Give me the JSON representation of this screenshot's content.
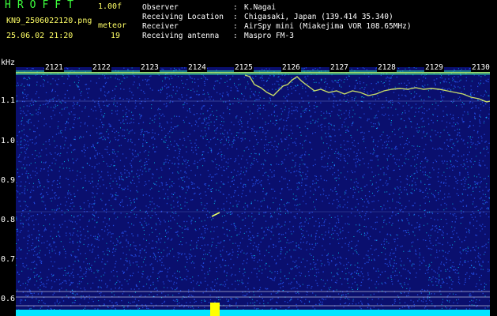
{
  "header": {
    "app_title": "HROFFT",
    "version": "1.00f",
    "filename": "KN9_2506022120.png",
    "mode": "meteor",
    "datetime": "25.06.02 21:20",
    "count": "19"
  },
  "info": [
    {
      "key": "Observer",
      "sep": ":",
      "value": "K.Nagai"
    },
    {
      "key": "Receiving Location",
      "sep": ":",
      "value": "Chigasaki, Japan (139.414 35.340)"
    },
    {
      "key": "Receiver",
      "sep": ":",
      "value": "AirSpy mini (Miakejima VOR 108.65MHz)"
    },
    {
      "key": "Receiving antenna",
      "sep": ":",
      "value": "Maspro FM-3"
    }
  ],
  "axis": {
    "unit": "kHz",
    "time_labels": [
      "2121",
      "2122",
      "2123",
      "2124",
      "2125",
      "2126",
      "2127",
      "2128",
      "2129",
      "2130"
    ],
    "freq_labels": [
      "1.1",
      "1.0",
      "0.9",
      "0.8",
      "0.7",
      "0.6"
    ]
  },
  "colors": {
    "background": "#0a0f6e",
    "noise_low": "#2a5cff",
    "noise_high": "#00e5ff",
    "trace": "#e8ff66",
    "baseline": "#00e5ff",
    "title": "#3dff3d",
    "meta": "#ffff66"
  }
}
